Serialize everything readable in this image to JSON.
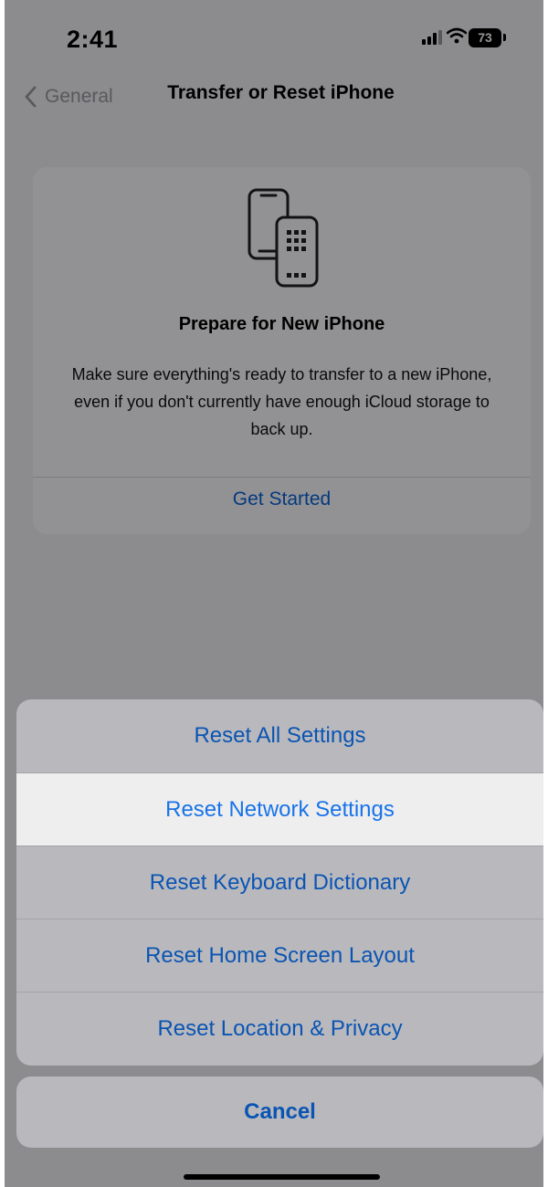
{
  "status_bar": {
    "time": "2:41",
    "battery_level": "73"
  },
  "nav": {
    "back_label": "General",
    "title": "Transfer or Reset iPhone"
  },
  "card": {
    "title": "Prepare for New iPhone",
    "description": "Make sure everything's ready to transfer to a new iPhone, even if you don't currently have enough iCloud storage to back up.",
    "action_label": "Get Started",
    "icon": "two-phones-icon"
  },
  "action_sheet": {
    "items": [
      {
        "label": "Reset All Settings"
      },
      {
        "label": "Reset Network Settings",
        "highlighted": true
      },
      {
        "label": "Reset Keyboard Dictionary"
      },
      {
        "label": "Reset Home Screen Layout"
      },
      {
        "label": "Reset Location & Privacy"
      }
    ],
    "cancel_label": "Cancel"
  },
  "colors": {
    "accent": "#0a63d9",
    "background": "#f1f1f6",
    "card": "#fcfcff"
  }
}
